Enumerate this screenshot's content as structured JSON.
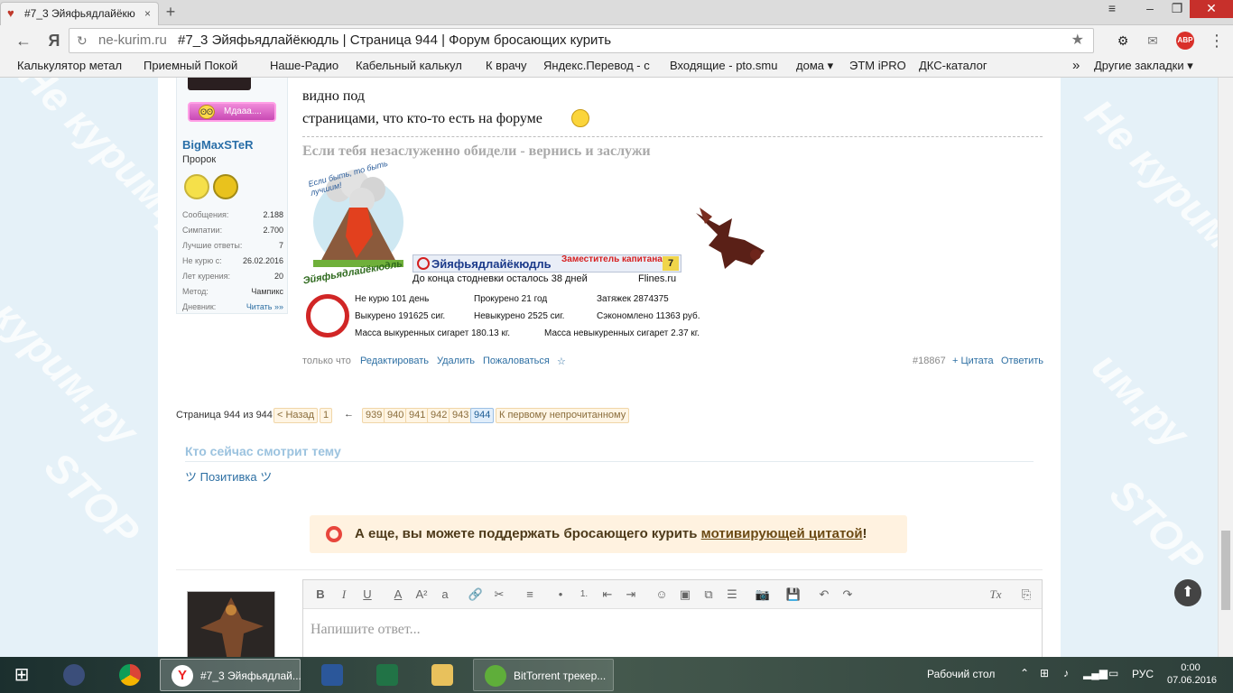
{
  "browser": {
    "tab_title": "#7_3 Эйяфьядлайёкю",
    "address_domain": "ne-kurim.ru",
    "address_path": "#7_3 Эйяфьядлайёкюдль | Страница 944 | Форум бросающих курить",
    "bookmarks": [
      "Калькулятор метал",
      "Приемный Покой",
      "Наше-Радио",
      "Кабельный калькул",
      "К врачу",
      "Яндекс.Перевод - с",
      "Входящие - pto.smu",
      "дома ▾",
      "ЭТМ iPRO",
      "ДКС-каталог"
    ],
    "bookmarks_more": "»",
    "other_bookmarks": "Другие закладки ▾",
    "abp_label": "ABP",
    "tab_close": "×",
    "newtab": "+"
  },
  "watermark": [
    "Не курим.ру",
    "STOP",
    "курим.ру",
    "Не курим",
    "им.ру",
    "STOP"
  ],
  "sidebar": {
    "mood_label": "Мдааа....",
    "username": "BigMaxSTeR",
    "rank": "Пророк",
    "stats": [
      {
        "label": "Сообщения:",
        "value": "2.188"
      },
      {
        "label": "Симпатии:",
        "value": "2.700"
      },
      {
        "label": "Лучшие ответы:",
        "value": "7"
      },
      {
        "label": "Не курю с:",
        "value": "26.02.2016"
      },
      {
        "label": "Лет курения:",
        "value": "20"
      },
      {
        "label": "Метод:",
        "value": "Чампикс"
      },
      {
        "label": "Дневник:",
        "value": "Читать »»"
      }
    ]
  },
  "post": {
    "line1": "видно под",
    "line2": "страницами, что кто-то есть на форуме",
    "signature": "Если тебя незаслуженно обидели - вернись и заслужи",
    "volcano_caption": "Если быть, то быть лучшим!",
    "volcano_brand": "Эйяфьядлайёкюдль",
    "banner_title": "Эйяфьядлайёкюдль",
    "banner_role": "Заместитель капитана",
    "banner_level": "7",
    "countdown": "До конца стодневки осталось 38 дней",
    "site": "Flines.ru",
    "stats": [
      "Не курю 101 день",
      "Прокурено 21 год",
      "Затяжек 2874375",
      "Выкурено 191625 сиг.",
      "Невыкурено 2525 сиг.",
      "Сэкономлено 11363 руб.",
      "Масса выкуренных сигарет 180.13 кг.",
      "Масса невыкуренных сигарет 2.37 кг."
    ],
    "actions": {
      "time": "только что",
      "edit": "Редактировать",
      "delete": "Удалить",
      "report": "Пожаловаться",
      "star": "☆",
      "post_no": "#18867",
      "quote": "+ Цитата",
      "reply": "Ответить"
    }
  },
  "pagination": {
    "label": "Страница 944 из 944",
    "prev": "< Назад",
    "first": "1",
    "arrow": "←",
    "pages": [
      "939",
      "940",
      "941",
      "942",
      "943",
      "944"
    ],
    "current": "944",
    "unread": "К первому непрочитанному"
  },
  "watching": {
    "title": "Кто сейчас смотрит тему",
    "user": "ツ Позитивка ツ"
  },
  "promo": {
    "text_before": "А еще, вы можете поддержать бросающего курить ",
    "link": "мотивирующей цитатой",
    "text_after": "!"
  },
  "editor": {
    "placeholder": "Напишите ответ...",
    "tools": [
      "B",
      "I",
      "U",
      "A",
      "A²",
      "a",
      "🔗",
      "✂",
      "≡",
      "•",
      "1.",
      "⇤",
      "⇥",
      "☺",
      "▣",
      "⧉",
      "☰",
      "📷",
      "💾",
      "↶",
      "↷",
      "Tx",
      "⎘"
    ]
  },
  "taskbar": {
    "yandex_title": "#7_3 Эйяфьядлай...",
    "torrent_title": "BitTorrent трекер...",
    "desktop": "Рабочий стол",
    "lang": "РУС",
    "time": "0:00",
    "date": "07.06.2016"
  },
  "colors": {
    "link": "#2d6fa3",
    "page_bg": "#e5f1f8",
    "promo_bg": "#fff2e0",
    "close_button": "#c7302b"
  }
}
